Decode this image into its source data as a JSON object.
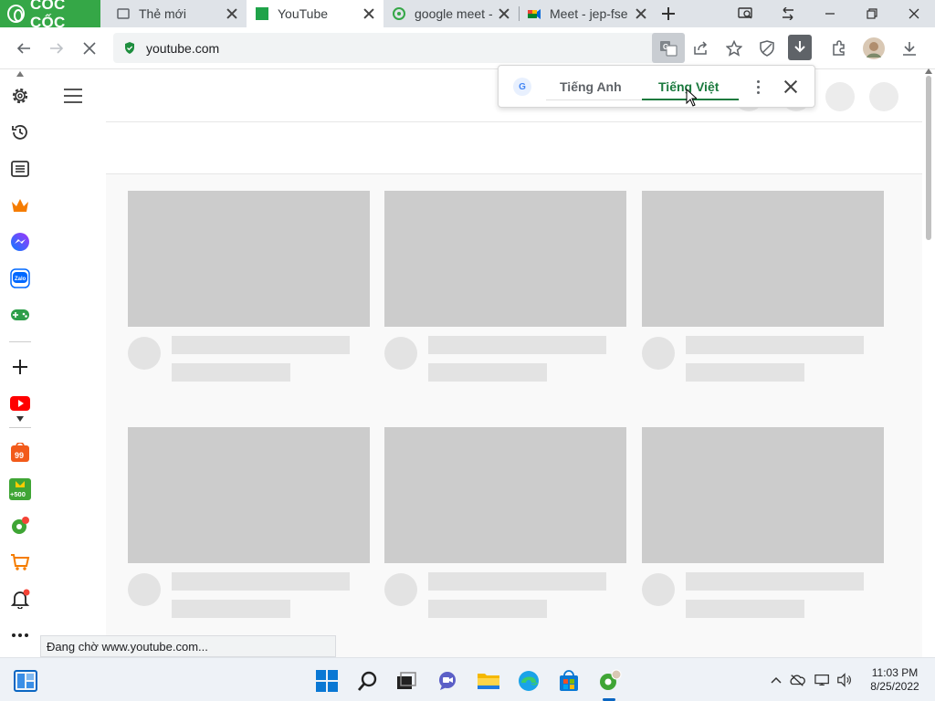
{
  "browser": {
    "brand": "CỐC CỐC",
    "tabs": [
      {
        "title": "Thẻ mới",
        "active": false
      },
      {
        "title": "YouTube",
        "active": true
      },
      {
        "title": "google meet -",
        "active": false
      },
      {
        "title": "Meet - jep-fse",
        "active": false
      }
    ],
    "url": "youtube.com",
    "status": "Đang chờ www.youtube.com..."
  },
  "translate_popup": {
    "source_lang": "Tiếng Anh",
    "target_lang": "Tiếng Việt",
    "selected": "Tiếng Việt"
  },
  "sidebar": {
    "items": [
      "settings-icon",
      "history-icon",
      "reading-list-icon",
      "crown-icon",
      "messenger-icon",
      "zalo-icon",
      "gamepad-icon",
      "add-icon",
      "youtube-icon",
      "shopping-99-icon",
      "plus500-icon",
      "coccoc-icon",
      "cart-icon",
      "bell-icon",
      "more-icon"
    ]
  },
  "taskbar": {
    "time": "11:03 PM",
    "date": "8/25/2022"
  },
  "colors": {
    "brand_green": "#35a747",
    "translate_selected": "#1b7a3e",
    "placeholder_thumb": "#cccccc",
    "placeholder_line": "#e3e3e3"
  }
}
